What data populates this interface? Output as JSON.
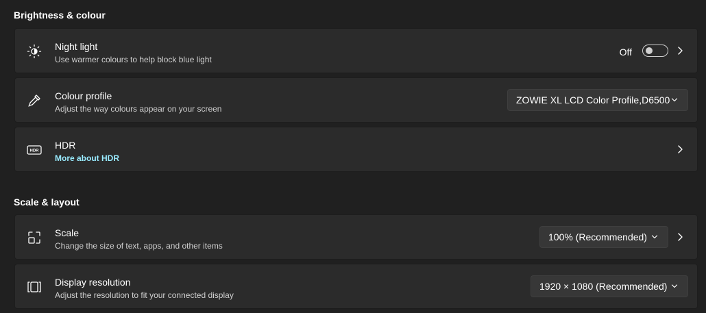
{
  "sections": {
    "brightness_title": "Brightness & colour",
    "scale_title": "Scale & layout"
  },
  "night_light": {
    "icon": "brightness-sun-icon",
    "title": "Night light",
    "description": "Use warmer colours to help block blue light",
    "toggle_label": "Off",
    "toggle_on": false
  },
  "colour_profile": {
    "icon": "eyedropper-icon",
    "title": "Colour profile",
    "description": "Adjust the way colours appear on your screen",
    "selected": "ZOWIE XL LCD Color Profile,D6500"
  },
  "hdr": {
    "icon": "hdr-icon",
    "title": "HDR",
    "link": "More about HDR"
  },
  "scale": {
    "icon": "scale-icon",
    "title": "Scale",
    "description": "Change the size of text, apps, and other items",
    "selected": "100% (Recommended)"
  },
  "resolution": {
    "icon": "resolution-icon",
    "title": "Display resolution",
    "description": "Adjust the resolution to fit your connected display",
    "selected": "1920 × 1080 (Recommended)"
  },
  "colors": {
    "background": "#202020",
    "card": "#2b2b2b",
    "link": "#99ebff"
  }
}
